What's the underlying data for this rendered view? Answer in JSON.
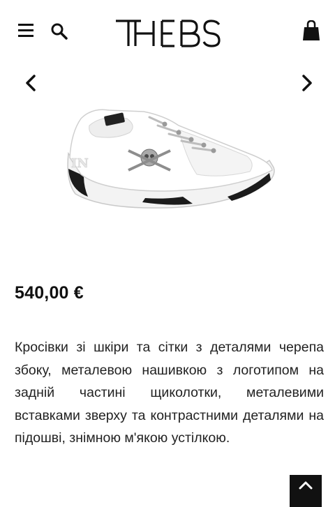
{
  "header": {
    "logo_text": "THEBS",
    "icons": {
      "menu": "menu-icon",
      "search": "search-icon",
      "cart": "shopping-bag-icon"
    }
  },
  "gallery": {
    "icons": {
      "previous": "chevron-left-icon",
      "next": "chevron-right-icon"
    }
  },
  "product": {
    "price": "540,00 €",
    "description": "Кросівки зі шкіри та сітки з деталями черепа збоку, металевою нашивкою з логотипом на задній частині щиколотки, металевими вставками зверху та контрастними деталями на підошві, знімною м'якою устілкою."
  },
  "colors": {
    "text": "#111111",
    "background": "#ffffff",
    "button": "#111111"
  },
  "scroll_top": {
    "icon": "chevron-up-icon"
  }
}
